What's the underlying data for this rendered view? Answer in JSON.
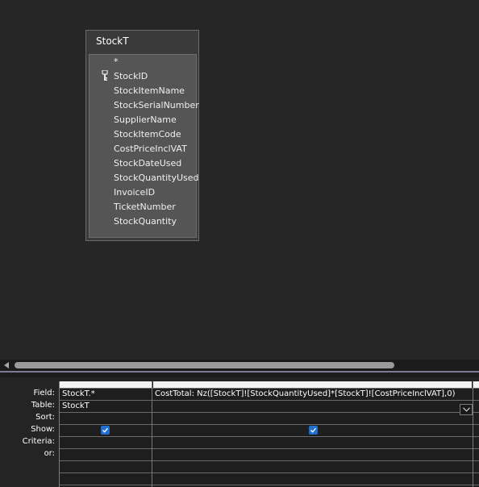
{
  "table_box": {
    "title": "StockT",
    "fields": [
      {
        "name": "*",
        "primary_key": false
      },
      {
        "name": "StockID",
        "primary_key": true
      },
      {
        "name": "StockItemName",
        "primary_key": false
      },
      {
        "name": "StockSerialNumber",
        "primary_key": false
      },
      {
        "name": "SupplierName",
        "primary_key": false
      },
      {
        "name": "StockItemCode",
        "primary_key": false
      },
      {
        "name": "CostPriceInclVAT",
        "primary_key": false
      },
      {
        "name": "StockDateUsed",
        "primary_key": false
      },
      {
        "name": "StockQuantityUsed",
        "primary_key": false
      },
      {
        "name": "InvoiceID",
        "primary_key": false
      },
      {
        "name": "TicketNumber",
        "primary_key": false
      },
      {
        "name": "StockQuantity",
        "primary_key": false
      }
    ]
  },
  "design_grid": {
    "row_labels": {
      "field": "Field:",
      "table": "Table:",
      "sort": "Sort:",
      "show": "Show:",
      "criteria": "Criteria:",
      "or": "or:"
    },
    "columns": [
      {
        "field": "StockT.*",
        "table": "StockT",
        "sort": "",
        "show": true,
        "criteria": "",
        "or": ""
      },
      {
        "field": "CostTotal: Nz([StockT]![StockQuantityUsed]*[StockT]![CostPriceInclVAT],0)",
        "table": "",
        "sort": "",
        "show": true,
        "criteria": "",
        "or": ""
      }
    ]
  },
  "colors": {
    "background": "#262626",
    "field_list": "#555555",
    "checkbox": "#1f6fd1"
  },
  "icons": {
    "primary_key": "key-icon",
    "dropdown": "chevron-down-icon",
    "scroll_left": "arrow-left-icon"
  }
}
